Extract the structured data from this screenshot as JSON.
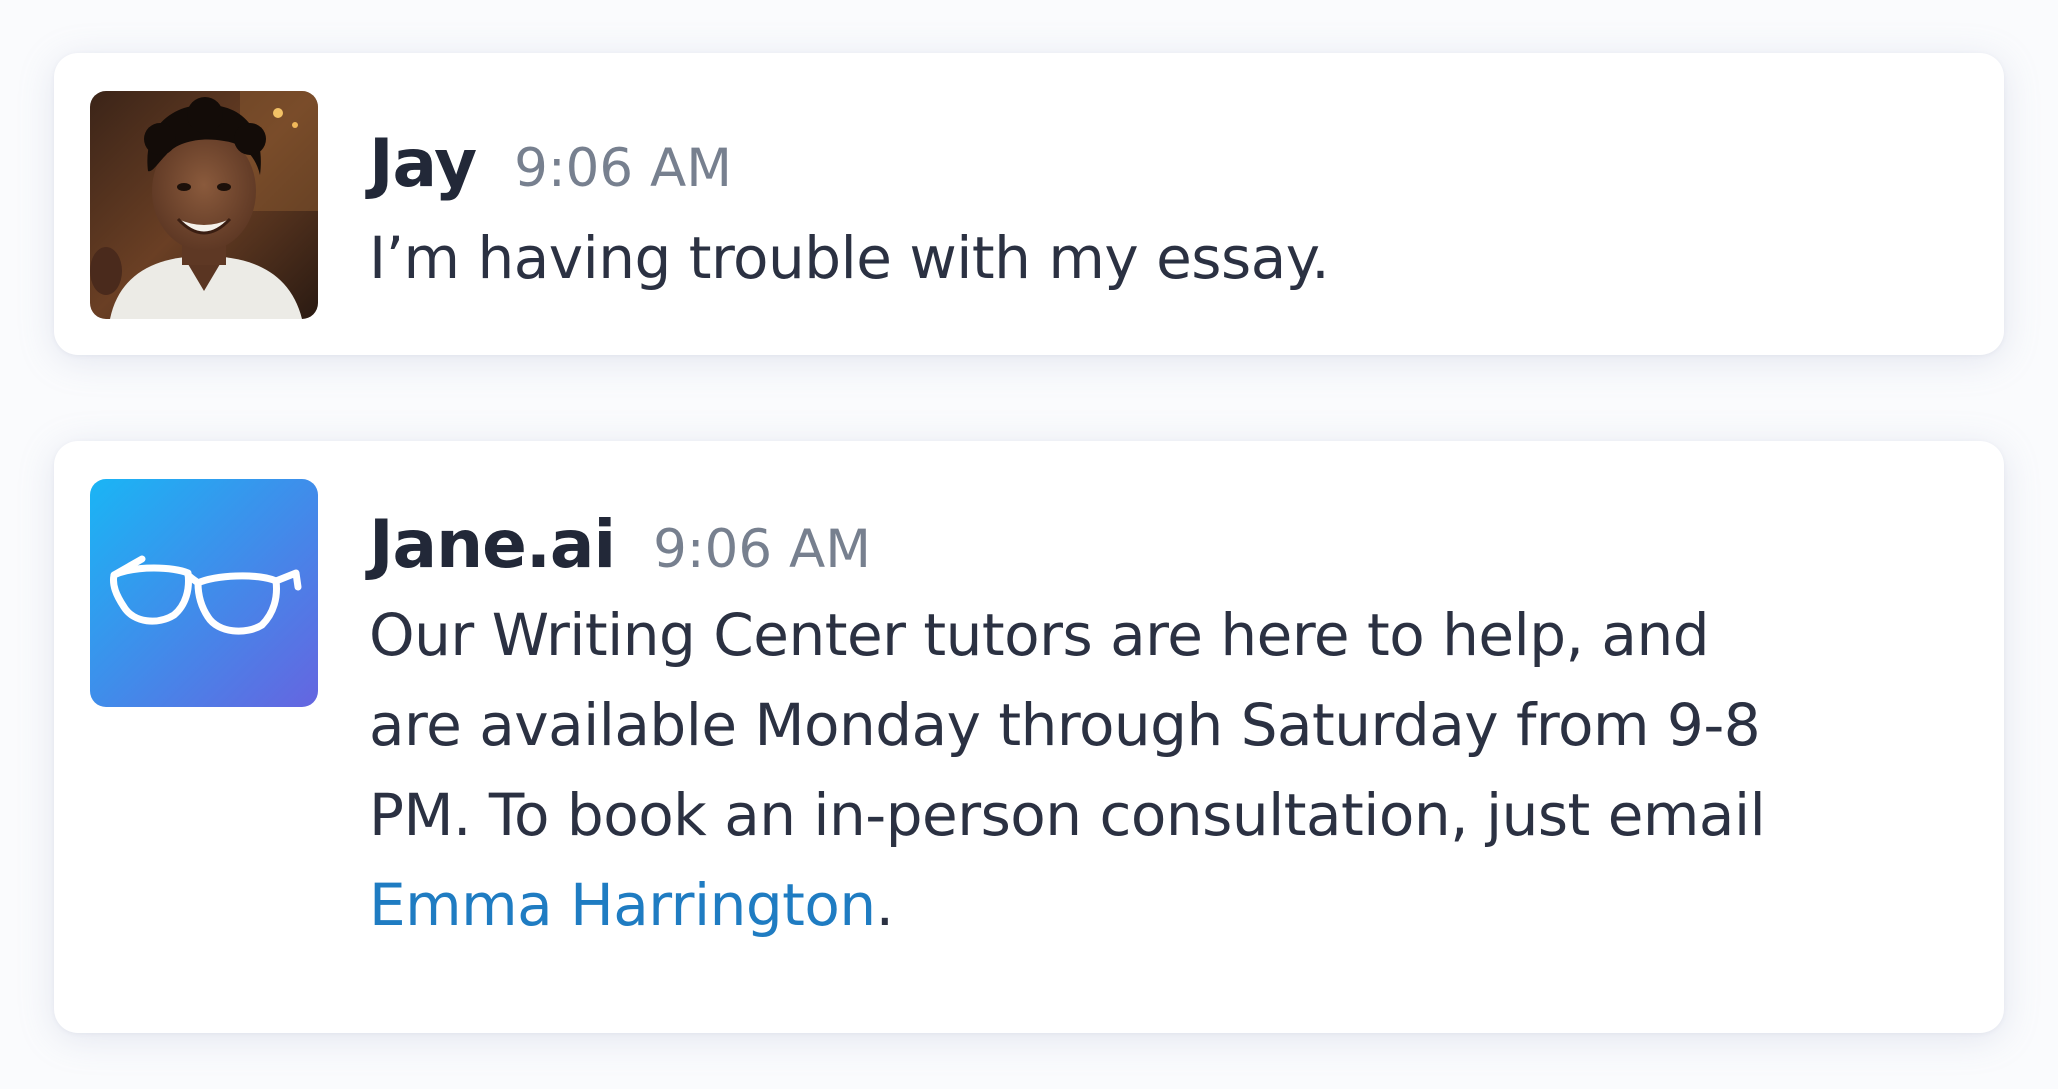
{
  "messages": [
    {
      "sender": "Jay",
      "time": "9:06 AM",
      "text": "I’m having trouble with my essay.",
      "avatar": "user-photo"
    },
    {
      "sender": "Jane.ai",
      "time": "9:06 AM",
      "text_lines": [
        "Our Writing Center tutors are here to help, and",
        "are available Monday through Saturday from 9-8",
        "PM. To book an in-person consultation, just email"
      ],
      "link_text": "Emma Harrington",
      "trailing": ".",
      "avatar": "glasses-icon"
    }
  ],
  "colors": {
    "link": "#1f7cc2",
    "logo_gradient_start": "#1ab5f5",
    "logo_gradient_end": "#6565e0",
    "timestamp": "#77808f"
  }
}
